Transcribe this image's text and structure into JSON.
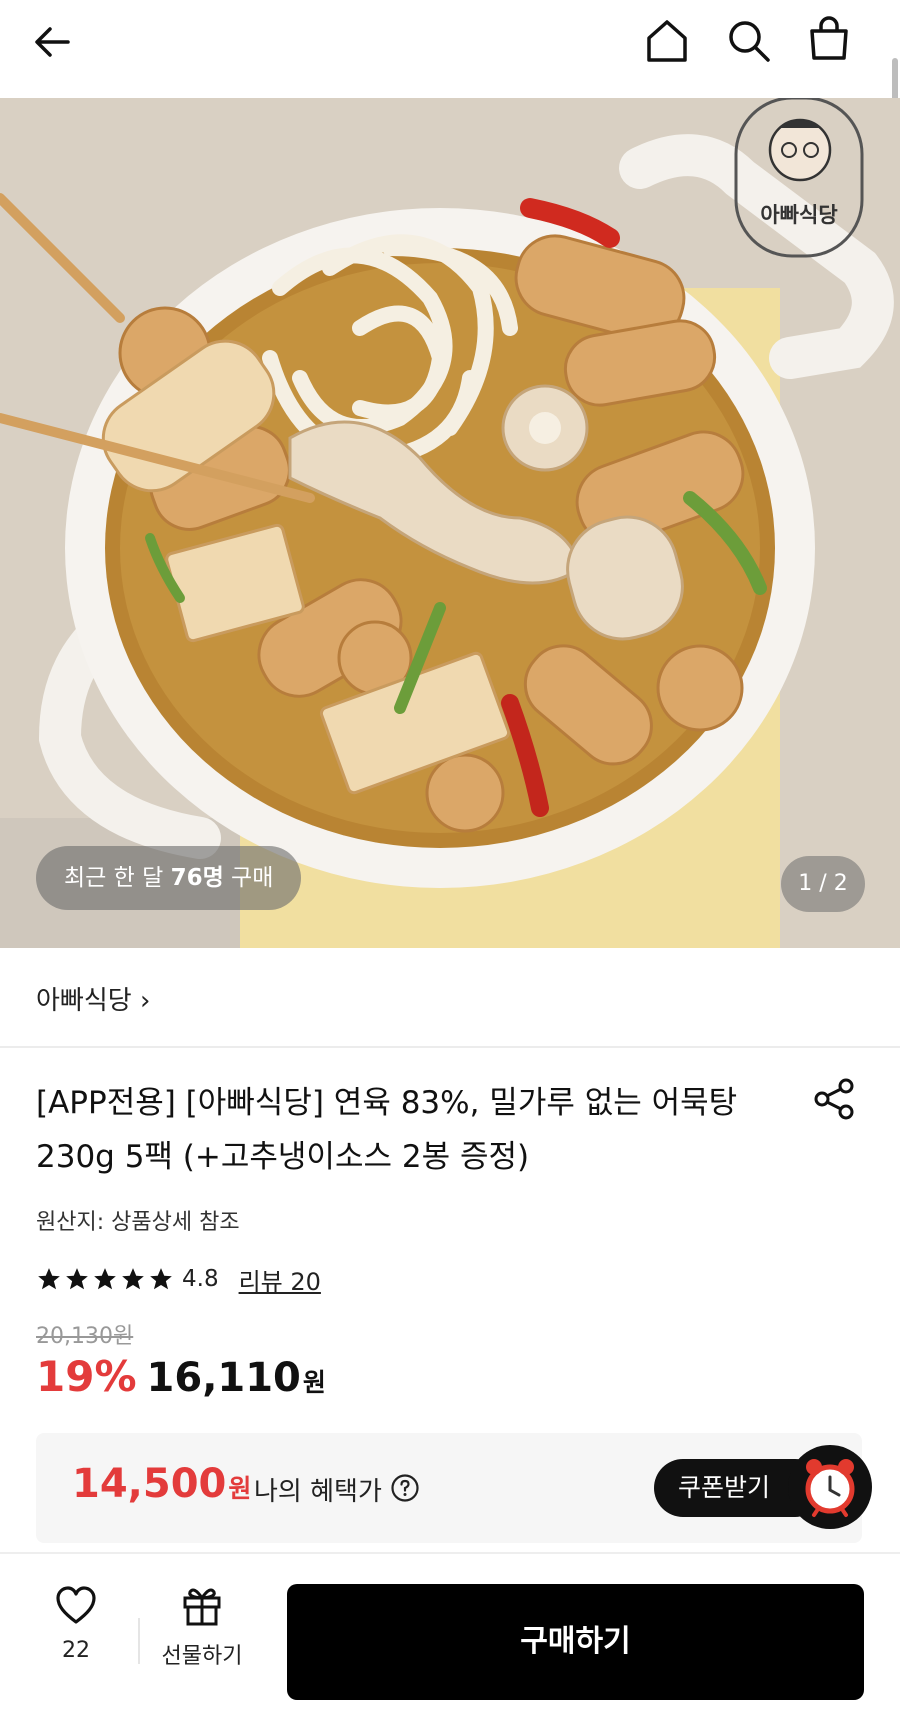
{
  "header": {
    "icons": [
      "arrow-left-icon",
      "home-icon",
      "search-icon",
      "shopping-bag-icon"
    ]
  },
  "hero": {
    "buyers_prefix": "최근 한 달 ",
    "buyers_count": "76명",
    "buyers_suffix": " 구매",
    "page_indicator": "1 / 2",
    "logo_text": "아빠식당"
  },
  "brand": {
    "link": "아빠식당 ›"
  },
  "product": {
    "title": "[APP전용] [아빠식당] 연육 83%, 밀가루 없는 어묵탕 230g 5팩 (+고추냉이소스 2봉 증정)",
    "origin": "원산지: 상품상세 참조",
    "rating": "4.8",
    "stars": 5,
    "review_link": "리뷰 20",
    "original_price": "20,130원",
    "discount": "19%",
    "price": "16,110",
    "currency": "원"
  },
  "benefit": {
    "price": "14,500",
    "currency": "원",
    "label": "나의 혜택가",
    "coupon_button": "쿠폰받기"
  },
  "bottom_bar": {
    "like_count": "22",
    "gift_label": "선물하기",
    "buy_label": "구매하기"
  },
  "colors": {
    "accent_red": "#e33b3b",
    "buy_button": "#000000"
  }
}
